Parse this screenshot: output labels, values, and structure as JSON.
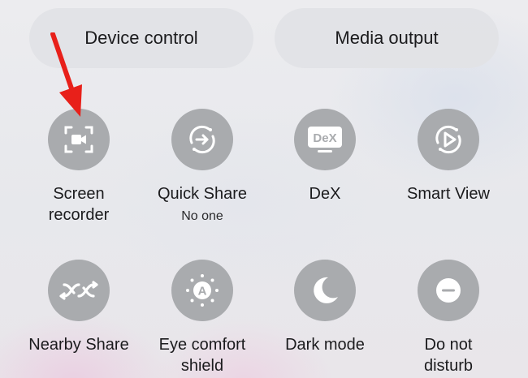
{
  "quick_panel": {
    "buttons": {
      "device_control": "Device control",
      "media_output": "Media output"
    },
    "tiles": [
      {
        "label": "Screen recorder",
        "label_lines": [
          "Screen",
          "recorder"
        ],
        "sub": "",
        "icon": "screen-recorder-icon"
      },
      {
        "label": "Quick Share",
        "label_lines": [
          "Quick Share",
          ""
        ],
        "sub": "No one",
        "icon": "quick-share-icon"
      },
      {
        "label": "DeX",
        "label_lines": [
          "DeX",
          ""
        ],
        "sub": "",
        "icon": "dex-icon"
      },
      {
        "label": "Smart View",
        "label_lines": [
          "Smart View",
          ""
        ],
        "sub": "",
        "icon": "smart-view-icon"
      },
      {
        "label": "Nearby Share",
        "label_lines": [
          "Nearby Share",
          ""
        ],
        "sub": "",
        "icon": "nearby-share-icon"
      },
      {
        "label": "Eye comfort shield",
        "label_lines": [
          "Eye comfort",
          "shield"
        ],
        "sub": "",
        "icon": "eye-comfort-shield-icon"
      },
      {
        "label": "Dark mode",
        "label_lines": [
          "Dark mode",
          ""
        ],
        "sub": "",
        "icon": "dark-mode-icon"
      },
      {
        "label": "Do not disturb",
        "label_lines": [
          "Do not",
          "disturb"
        ],
        "sub": "",
        "icon": "do-not-disturb-icon"
      }
    ],
    "dex_icon_text": "DeX",
    "eye_comfort_icon_text": "A"
  },
  "annotation": {
    "arrow_color": "#e8201a"
  },
  "colors": {
    "tile_off": "#a9abae",
    "icon_glyph": "#ffffff",
    "text": "#1b1b1d"
  }
}
